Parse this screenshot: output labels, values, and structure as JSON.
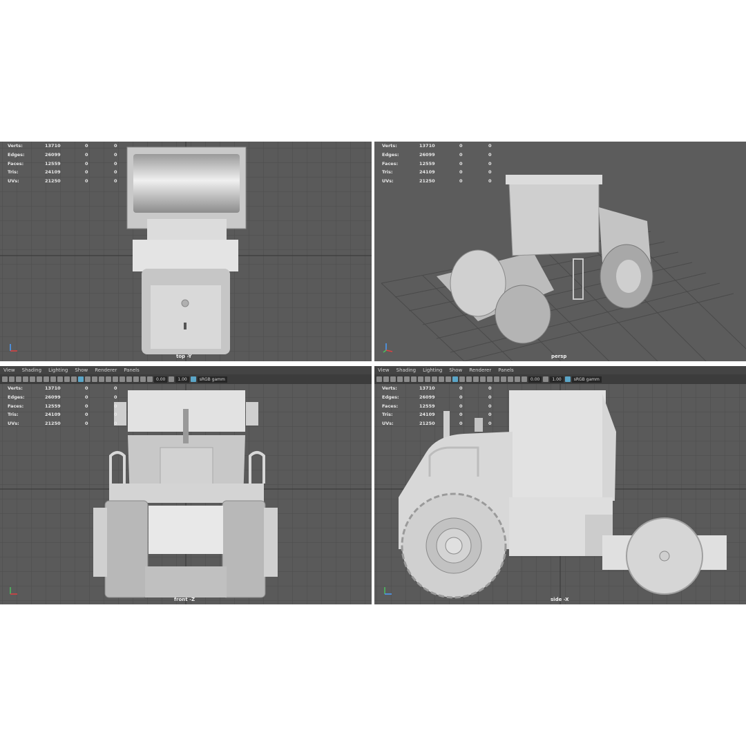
{
  "menu": [
    "View",
    "Shading",
    "Lighting",
    "Show",
    "Renderer",
    "Panels"
  ],
  "toolbar": {
    "exposure": "0.00",
    "gamma": "1.00",
    "colorspace": "sRGB gamm"
  },
  "hud_labels": [
    "Verts:",
    "Edges:",
    "Faces:",
    "Tris:",
    "UVs:"
  ],
  "hud_values": [
    [
      "13710",
      "0",
      "0"
    ],
    [
      "26099",
      "0",
      "0"
    ],
    [
      "12559",
      "0",
      "0"
    ],
    [
      "24109",
      "0",
      "0"
    ],
    [
      "21250",
      "0",
      "0"
    ]
  ],
  "viewports": {
    "top": {
      "label": "top -Y"
    },
    "persp": {
      "label": "persp"
    },
    "front": {
      "label": "front -Z"
    },
    "side": {
      "label": "side -X"
    }
  },
  "colors": {
    "viewport_bg": "#5a5a5a",
    "grid": "#4a4a4a",
    "model": "#d4d4d4",
    "active_icon": "#5ba6c8"
  }
}
